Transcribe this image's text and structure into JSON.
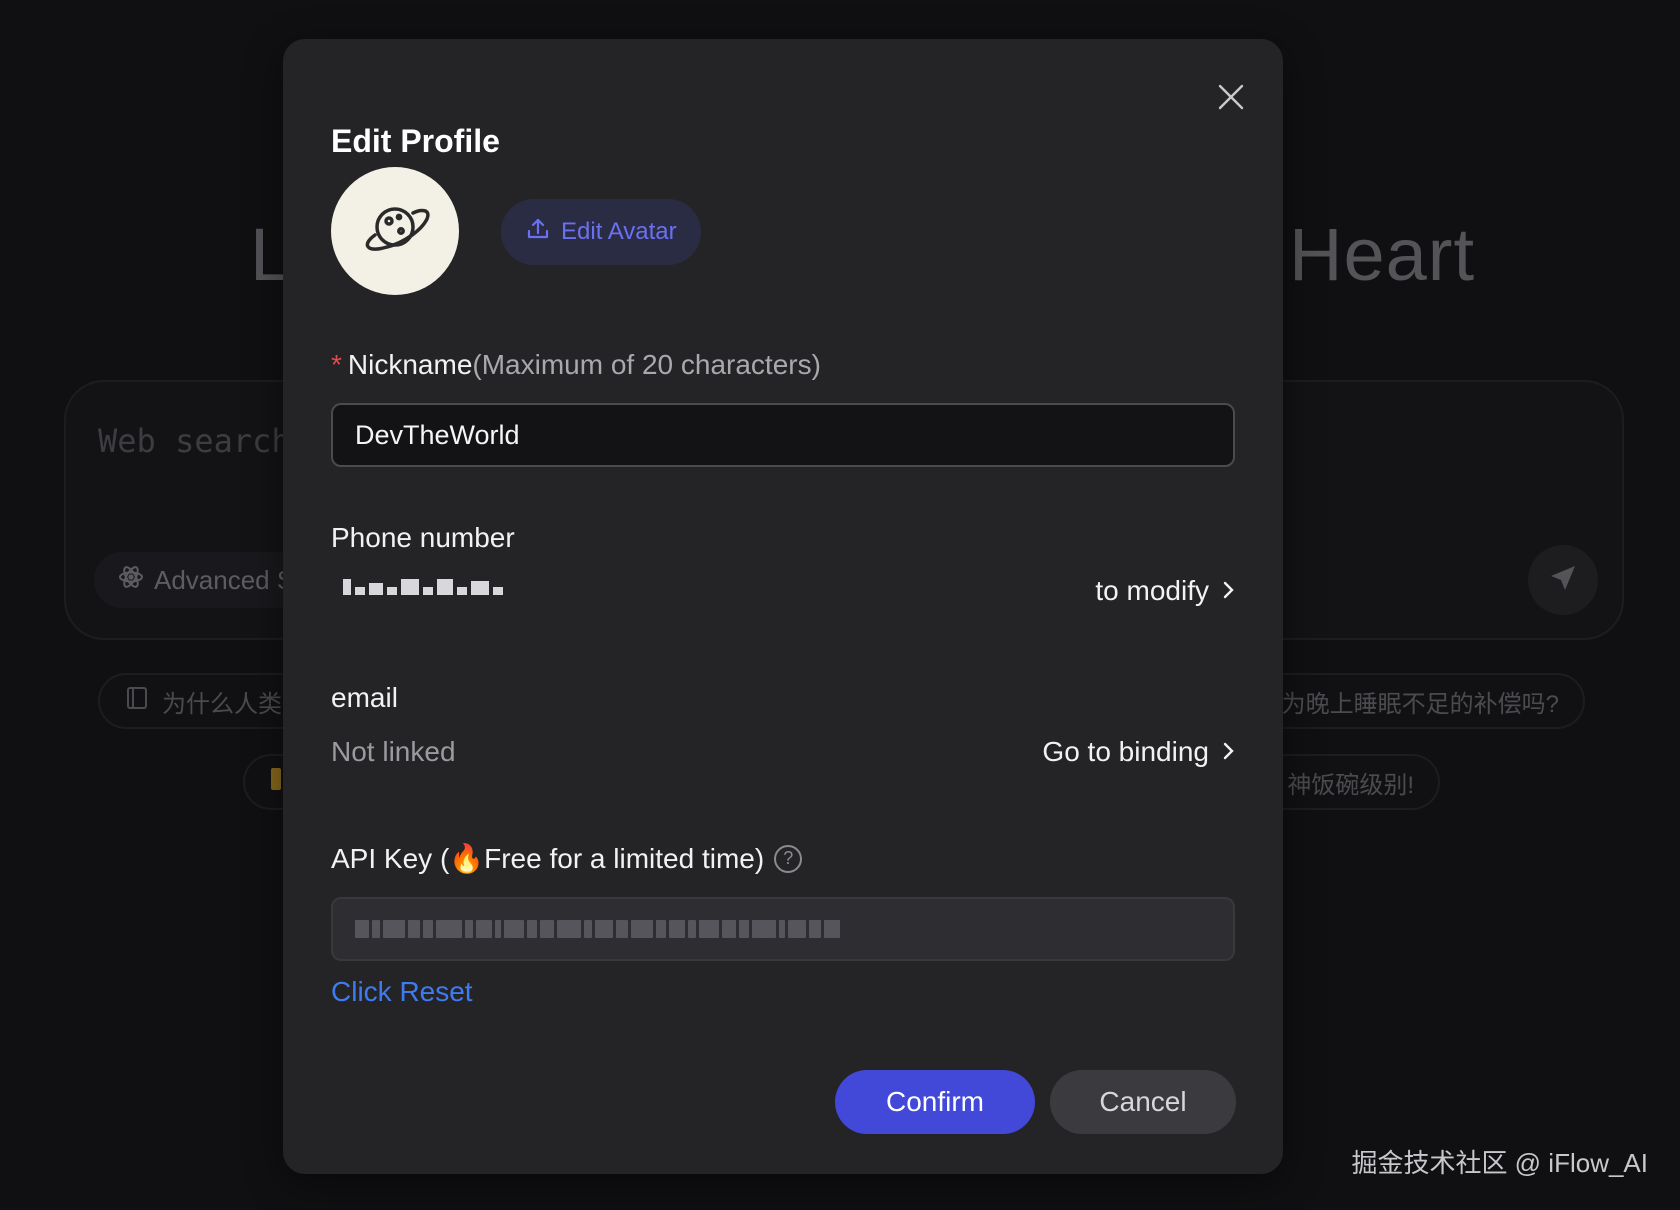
{
  "background": {
    "headline_left": "L",
    "headline_right": "Heart",
    "search_placeholder": "Web search",
    "advanced_label": "Advanced Se",
    "chips": [
      {
        "text": "为什么人类"
      },
      {
        "text": "为晚上睡眠不足的补偿吗?"
      },
      {
        "text": ""
      },
      {
        "text": "神饭碗级别!"
      }
    ]
  },
  "modal": {
    "title": "Edit Profile",
    "edit_avatar_label": "Edit Avatar",
    "nickname": {
      "label": "Nickname",
      "hint": "(Maximum of 20 characters)",
      "required_mark": "*",
      "value": "DevTheWorld"
    },
    "phone": {
      "label": "Phone number",
      "modify_link": "to modify"
    },
    "email": {
      "label": "email",
      "value": "Not linked",
      "binding_link": "Go to binding"
    },
    "api_key": {
      "label": "API Key (🔥Free for a limited time)",
      "help_symbol": "?",
      "reset_link": "Click Reset"
    },
    "confirm_label": "Confirm",
    "cancel_label": "Cancel"
  },
  "watermark": "掘金技术社区 @ iFlow_AI",
  "colors": {
    "accent": "#4248d8",
    "link": "#3f7bf0",
    "required": "#e5484d",
    "modal_bg": "#242427"
  }
}
